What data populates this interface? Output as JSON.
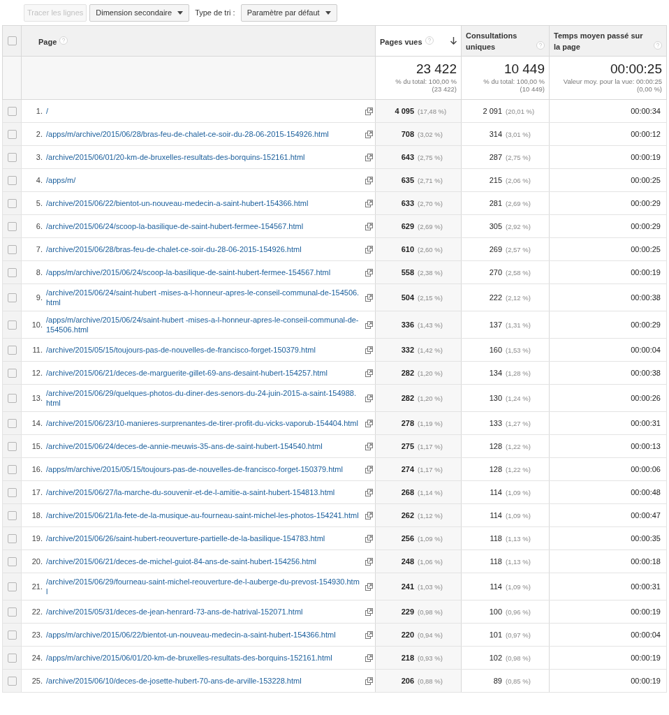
{
  "toolbar": {
    "plot_button": {
      "label": "Tracer les lignes",
      "disabled": true
    },
    "secondary_dimension": "Dimension secondaire",
    "sort_label": "Type de tri :",
    "sort_type": "Paramètre par défaut"
  },
  "table": {
    "select_all": {
      "checked": false
    },
    "columns": [
      {
        "label": "Page",
        "sorted": false
      },
      {
        "label": "Pages vues",
        "sorted": true
      },
      {
        "label": "Consultations uniques",
        "sorted": false
      },
      {
        "label": "Temps moyen passé sur la page",
        "sorted": false
      }
    ],
    "totals": [
      {
        "value": "23 422",
        "note": "% du total: 100,00 %",
        "sub": "(23 422)"
      },
      {
        "value": "10 449",
        "note": "% du total: 100,00 %",
        "sub": "(10 449)"
      },
      {
        "value": "00:00:25",
        "note": "Valeur moy. pour la vue: 00:00:25",
        "sub": "(0,00 %)"
      }
    ],
    "rows": [
      {
        "num": "1.",
        "url": "/",
        "views": "4 095",
        "views_pct": "(17,48 %)",
        "uniques": "2 091",
        "uniques_pct": "(20,01 %)",
        "time": "00:00:34",
        "checked": false
      },
      {
        "num": "2.",
        "url": "/apps/m/archive/2015/06/28/bras-feu-de-chalet-ce-soir-du-28-06-2015-154926.html",
        "views": "708",
        "views_pct": "(3,02 %)",
        "uniques": "314",
        "uniques_pct": "(3,01 %)",
        "time": "00:00:12",
        "checked": false
      },
      {
        "num": "3.",
        "url": "/archive/2015/06/01/20-km-de-bruxelles-resultats-des-borquins-152161.html",
        "views": "643",
        "views_pct": "(2,75 %)",
        "uniques": "287",
        "uniques_pct": "(2,75 %)",
        "time": "00:00:19",
        "checked": false
      },
      {
        "num": "4.",
        "url": "/apps/m/",
        "views": "635",
        "views_pct": "(2,71 %)",
        "uniques": "215",
        "uniques_pct": "(2,06 %)",
        "time": "00:00:25",
        "checked": false
      },
      {
        "num": "5.",
        "url": "/archive/2015/06/22/bientot-un-nouveau-medecin-a-saint-hubert-154366.html",
        "views": "633",
        "views_pct": "(2,70 %)",
        "uniques": "281",
        "uniques_pct": "(2,69 %)",
        "time": "00:00:29",
        "checked": false
      },
      {
        "num": "6.",
        "url": "/archive/2015/06/24/scoop-la-basilique-de-saint-hubert-fermee-154567.html",
        "views": "629",
        "views_pct": "(2,69 %)",
        "uniques": "305",
        "uniques_pct": "(2,92 %)",
        "time": "00:00:29",
        "checked": false
      },
      {
        "num": "7.",
        "url": "/archive/2015/06/28/bras-feu-de-chalet-ce-soir-du-28-06-2015-154926.html",
        "views": "610",
        "views_pct": "(2,60 %)",
        "uniques": "269",
        "uniques_pct": "(2,57 %)",
        "time": "00:00:25",
        "checked": false
      },
      {
        "num": "8.",
        "url": "/apps/m/archive/2015/06/24/scoop-la-basilique-de-saint-hubert-fermee-154567.html",
        "views": "558",
        "views_pct": "(2,38 %)",
        "uniques": "270",
        "uniques_pct": "(2,58 %)",
        "time": "00:00:19",
        "checked": false
      },
      {
        "num": "9.",
        "url": "/archive/2015/06/24/saint-hubert -mises-a-l-honneur-apres-le-conseil-communal-de-154506.html",
        "views": "504",
        "views_pct": "(2,15 %)",
        "uniques": "222",
        "uniques_pct": "(2,12 %)",
        "time": "00:00:38",
        "checked": false
      },
      {
        "num": "10.",
        "url": "/apps/m/archive/2015/06/24/saint-hubert -mises-a-l-honneur-apres-le-conseil-communal-de-154506.html",
        "views": "336",
        "views_pct": "(1,43 %)",
        "uniques": "137",
        "uniques_pct": "(1,31 %)",
        "time": "00:00:29",
        "checked": false
      },
      {
        "num": "11.",
        "url": "/archive/2015/05/15/toujours-pas-de-nouvelles-de-francisco-forget-150379.html",
        "views": "332",
        "views_pct": "(1,42 %)",
        "uniques": "160",
        "uniques_pct": "(1,53 %)",
        "time": "00:00:04",
        "checked": false
      },
      {
        "num": "12.",
        "url": "/archive/2015/06/21/deces-de-marguerite-gillet-69-ans-desaint-hubert-154257.html",
        "views": "282",
        "views_pct": "(1,20 %)",
        "uniques": "134",
        "uniques_pct": "(1,28 %)",
        "time": "00:00:38",
        "checked": false
      },
      {
        "num": "13.",
        "url": "/archive/2015/06/29/quelques-photos-du-diner-des-senors-du-24-juin-2015-a-saint-154988.html",
        "views": "282",
        "views_pct": "(1,20 %)",
        "uniques": "130",
        "uniques_pct": "(1,24 %)",
        "time": "00:00:26",
        "checked": false
      },
      {
        "num": "14.",
        "url": "/archive/2015/06/23/10-manieres-surprenantes-de-tirer-profit-du-vicks-vaporub-154404.html",
        "views": "278",
        "views_pct": "(1,19 %)",
        "uniques": "133",
        "uniques_pct": "(1,27 %)",
        "time": "00:00:31",
        "checked": false
      },
      {
        "num": "15.",
        "url": "/archive/2015/06/24/deces-de-annie-meuwis-35-ans-de-saint-hubert-154540.html",
        "views": "275",
        "views_pct": "(1,17 %)",
        "uniques": "128",
        "uniques_pct": "(1,22 %)",
        "time": "00:00:13",
        "checked": false
      },
      {
        "num": "16.",
        "url": "/apps/m/archive/2015/05/15/toujours-pas-de-nouvelles-de-francisco-forget-150379.html",
        "views": "274",
        "views_pct": "(1,17 %)",
        "uniques": "128",
        "uniques_pct": "(1,22 %)",
        "time": "00:00:06",
        "checked": false
      },
      {
        "num": "17.",
        "url": "/archive/2015/06/27/la-marche-du-souvenir-et-de-l-amitie-a-saint-hubert-154813.html",
        "views": "268",
        "views_pct": "(1,14 %)",
        "uniques": "114",
        "uniques_pct": "(1,09 %)",
        "time": "00:00:48",
        "checked": false
      },
      {
        "num": "18.",
        "url": "/archive/2015/06/21/la-fete-de-la-musique-au-fourneau-saint-michel-les-photos-154241.html",
        "views": "262",
        "views_pct": "(1,12 %)",
        "uniques": "114",
        "uniques_pct": "(1,09 %)",
        "time": "00:00:47",
        "checked": false
      },
      {
        "num": "19.",
        "url": "/archive/2015/06/26/saint-hubert-reouverture-partielle-de-la-basilique-154783.html",
        "views": "256",
        "views_pct": "(1,09 %)",
        "uniques": "118",
        "uniques_pct": "(1,13 %)",
        "time": "00:00:35",
        "checked": false
      },
      {
        "num": "20.",
        "url": "/archive/2015/06/21/deces-de-michel-guiot-84-ans-de-saint-hubert-154256.html",
        "views": "248",
        "views_pct": "(1,06 %)",
        "uniques": "118",
        "uniques_pct": "(1,13 %)",
        "time": "00:00:18",
        "checked": false
      },
      {
        "num": "21.",
        "url": "/archive/2015/06/29/fourneau-saint-michel-reouverture-de-l-auberge-du-prevost-154930.html",
        "views": "241",
        "views_pct": "(1,03 %)",
        "uniques": "114",
        "uniques_pct": "(1,09 %)",
        "time": "00:00:31",
        "checked": false
      },
      {
        "num": "22.",
        "url": "/archive/2015/05/31/deces-de-jean-henrard-73-ans-de-hatrival-152071.html",
        "views": "229",
        "views_pct": "(0,98 %)",
        "uniques": "100",
        "uniques_pct": "(0,96 %)",
        "time": "00:00:19",
        "checked": false
      },
      {
        "num": "23.",
        "url": "/apps/m/archive/2015/06/22/bientot-un-nouveau-medecin-a-saint-hubert-154366.html",
        "views": "220",
        "views_pct": "(0,94 %)",
        "uniques": "101",
        "uniques_pct": "(0,97 %)",
        "time": "00:00:04",
        "checked": false
      },
      {
        "num": "24.",
        "url": "/apps/m/archive/2015/06/01/20-km-de-bruxelles-resultats-des-borquins-152161.html",
        "views": "218",
        "views_pct": "(0,93 %)",
        "uniques": "102",
        "uniques_pct": "(0,98 %)",
        "time": "00:00:19",
        "checked": false
      },
      {
        "num": "25.",
        "url": "/archive/2015/06/10/deces-de-josette-hubert-70-ans-de-arville-153228.html",
        "views": "206",
        "views_pct": "(0,88 %)",
        "uniques": "89",
        "uniques_pct": "(0,85 %)",
        "time": "00:00:19",
        "checked": false
      }
    ]
  }
}
